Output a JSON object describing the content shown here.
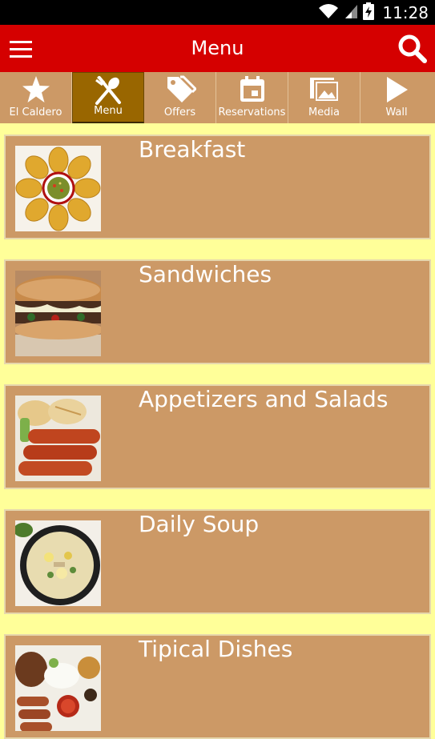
{
  "status_bar": {
    "time": "11:28",
    "icons": [
      "wifi-icon",
      "signal-icon",
      "battery-charging-icon"
    ]
  },
  "app_bar": {
    "title": "Menu",
    "menu_icon": "hamburger-icon",
    "search_icon": "search-icon",
    "color": "#D50000"
  },
  "tabs": [
    {
      "label": "El Caldero",
      "icon": "star-icon",
      "active": false
    },
    {
      "label": "Menu",
      "icon": "fork-spoon-icon",
      "active": true
    },
    {
      "label": "Offers",
      "icon": "tags-icon",
      "active": false
    },
    {
      "label": "Reservations",
      "icon": "calendar-icon",
      "active": false
    },
    {
      "label": "Media",
      "icon": "images-icon",
      "active": false
    },
    {
      "label": "Wall",
      "icon": "play-icon",
      "active": false
    }
  ],
  "menu": {
    "items": [
      {
        "title": "Breakfast",
        "thumb_icon": "empanadas-photo"
      },
      {
        "title": "Sandwiches",
        "thumb_icon": "steak-sandwich-photo"
      },
      {
        "title": "Appetizers and Salads",
        "thumb_icon": "chorizo-arepa-photo"
      },
      {
        "title": "Daily Soup",
        "thumb_icon": "soup-bowl-photo"
      },
      {
        "title": "Tipical Dishes",
        "thumb_icon": "bandeja-paisa-photo"
      }
    ]
  },
  "colors": {
    "background": "#FFFF99",
    "card": "#CC9966",
    "tab_bar": "#CC9966",
    "tab_active": "#996600",
    "app_bar": "#D50000"
  }
}
